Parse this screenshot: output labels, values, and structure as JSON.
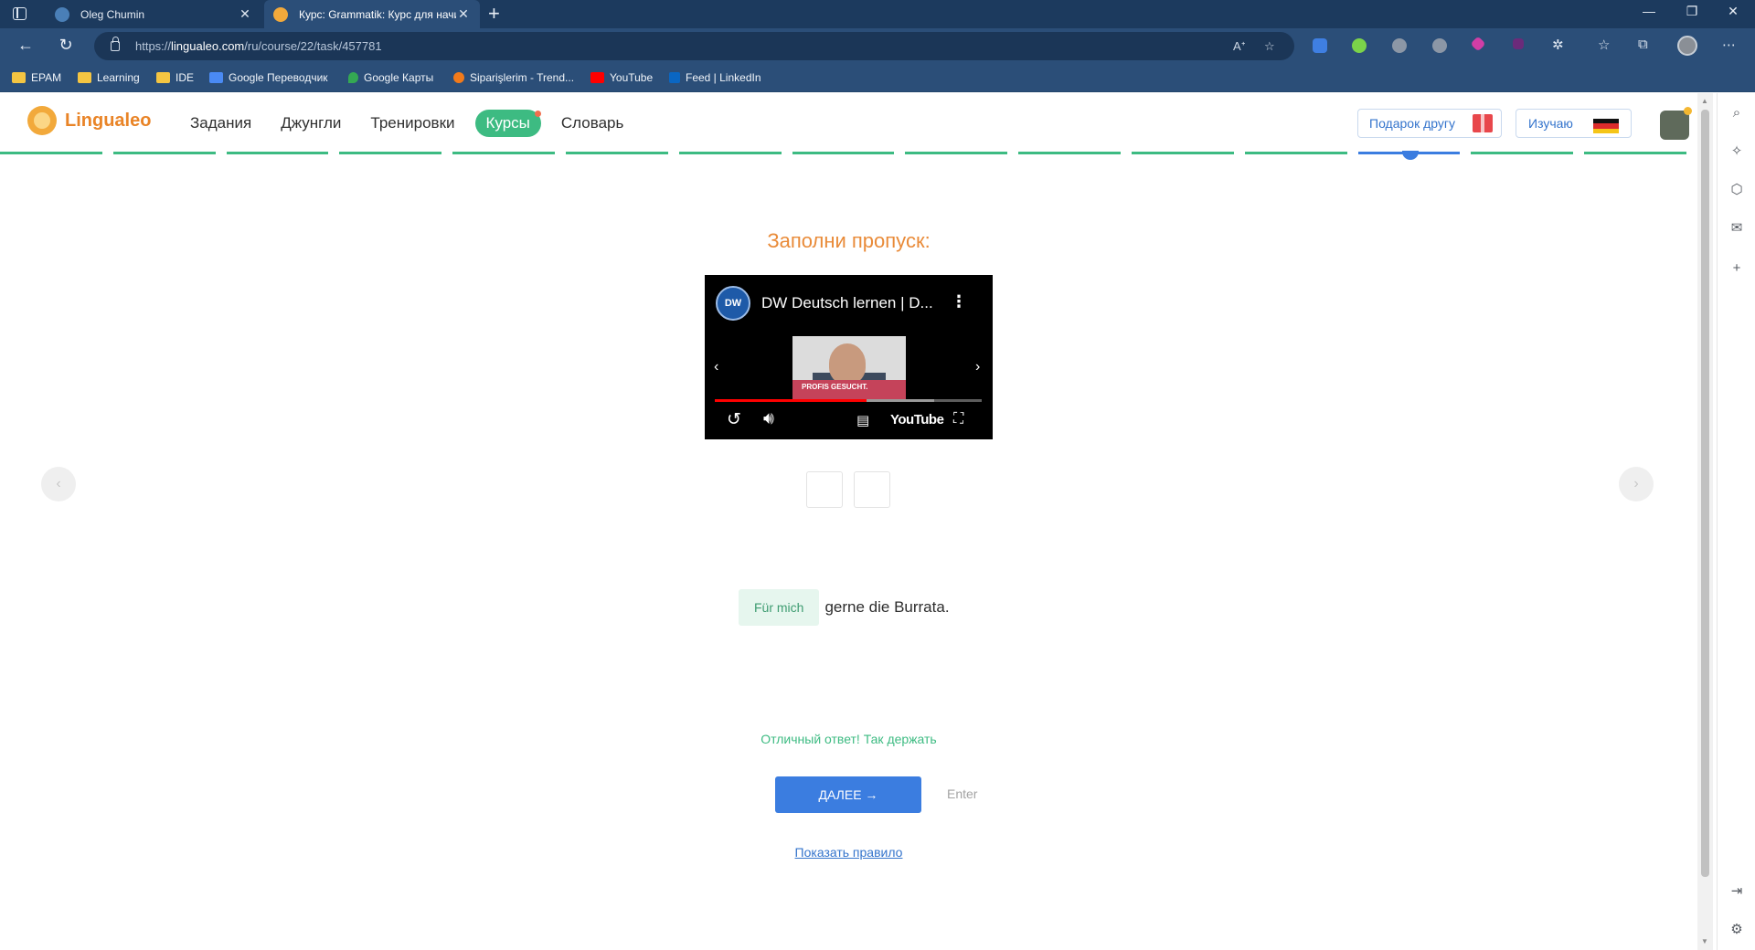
{
  "browser": {
    "tabs": [
      {
        "title": "Oleg Chumin",
        "active": false
      },
      {
        "title": "Курс: Grammatik: Курс для начи",
        "active": true
      }
    ],
    "new_tab": "+",
    "address": {
      "prefix": "https://",
      "host": "lingualeo.com",
      "path": "/ru/course/22/task/457781"
    },
    "window_controls": [
      "—",
      "❐",
      "✕"
    ],
    "bookmarks": [
      {
        "label": "EPAM",
        "icon": "folder-icon"
      },
      {
        "label": "Learning",
        "icon": "folder-icon"
      },
      {
        "label": "IDE",
        "icon": "folder-icon"
      },
      {
        "label": "Google Переводчик",
        "icon": "google-translate-icon"
      },
      {
        "label": "Google Карты",
        "icon": "google-maps-icon"
      },
      {
        "label": "Siparişlerim - Trend...",
        "icon": "trendyol-icon"
      },
      {
        "label": "YouTube",
        "icon": "youtube-icon"
      },
      {
        "label": "Feed | LinkedIn",
        "icon": "linkedin-icon"
      }
    ]
  },
  "header": {
    "logo_text": "Lingualeo",
    "nav": [
      {
        "label": "Задания",
        "active": false
      },
      {
        "label": "Джунгли",
        "active": false
      },
      {
        "label": "Тренировки",
        "active": false
      },
      {
        "label": "Курсы",
        "active": true
      },
      {
        "label": "Словарь",
        "active": false
      }
    ],
    "gift_label": "Подарок другу",
    "learning_label": "Изучаю",
    "progress_segments": 15,
    "current_segment": 13
  },
  "task": {
    "title": "Заполни пропуск:",
    "video": {
      "channel_logo": "DW",
      "title": "DW Deutsch lernen | D...",
      "thumb_text": "PROFIS GESUCHT.",
      "brand": "YouTube"
    },
    "answer": "Für mich",
    "sentence_rest": "gerne die Burrata.",
    "feedback": "Отличный ответ! Так держать",
    "next_label": "ДАЛЕЕ →",
    "enter_hint": "Enter",
    "rule_link": "Показать правило"
  },
  "colors": {
    "accent_green": "#3dbb82",
    "accent_blue": "#3b7de0",
    "title_orange": "#e98b39"
  }
}
